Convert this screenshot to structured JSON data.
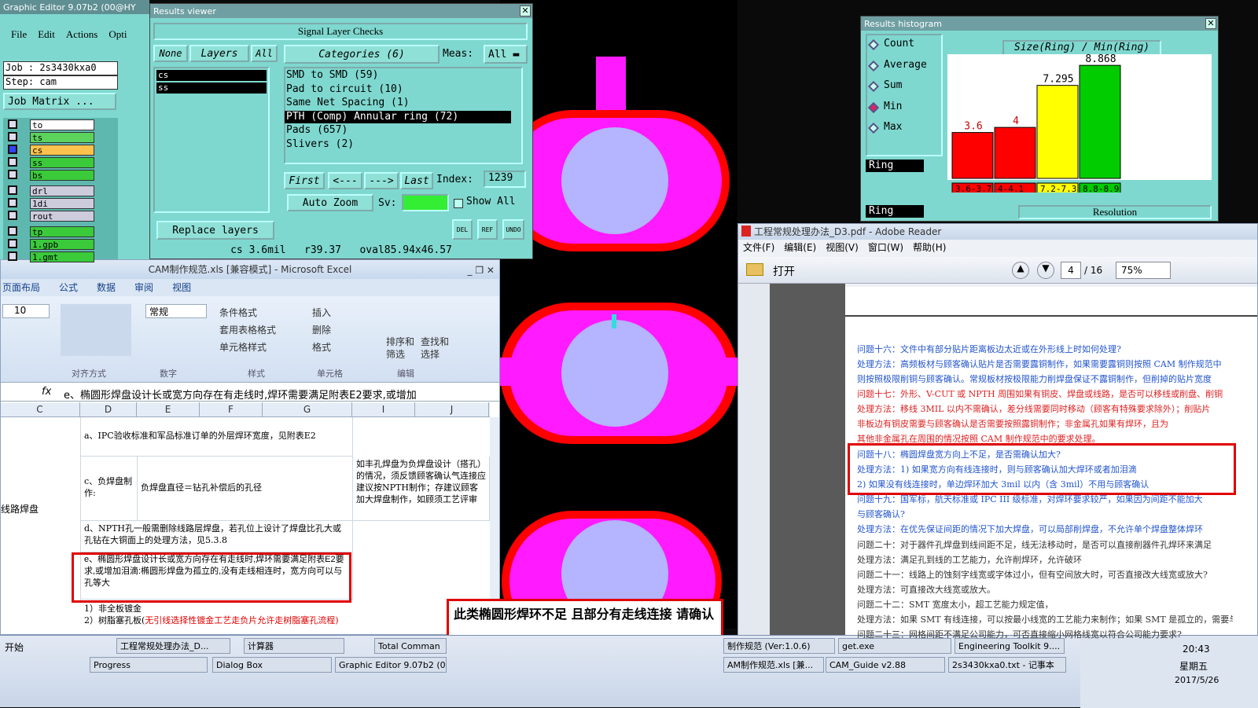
{
  "graphic_editor": {
    "title": "Graphic Editor 9.07b2 (00@HY",
    "menu": [
      "File",
      "Edit",
      "Actions",
      "Opti"
    ],
    "job": "Job : 2s3430kxa0",
    "step": "Step: cam",
    "job_matrix": "Job Matrix ...",
    "layers": [
      "to",
      "ts",
      "cs",
      "ss",
      "bs",
      "drl",
      "1di",
      "rout",
      "tp",
      "1.gpb",
      "1.gmt"
    ]
  },
  "results_viewer": {
    "title": "Results viewer",
    "header": "Signal Layer Checks",
    "none_btn": "None",
    "layers_btn": "Layers",
    "all_btn": "All",
    "categories_btn": "Categories (6)",
    "meas_label": "Meas:",
    "meas_value": "All",
    "layer_list": [
      "cs",
      "ss"
    ],
    "categories": [
      "SMD to SMD (59)",
      "Pad to circuit (10)",
      "Same Net Spacing (1)",
      "PTH (Comp) Annular ring (72)",
      "Pads (657)",
      "Slivers (2)"
    ],
    "first": "First",
    "prev": "<---",
    "next": "--->",
    "last": "Last",
    "index_label": "Index:",
    "index_value": "1239",
    "auto_zoom": "Auto Zoom",
    "sv_label": "Sv:",
    "show_all": "Show All",
    "replace_layers": "Replace layers",
    "del": "DEL",
    "ref": "REF",
    "undo": "UNDO",
    "status": "cs 3.6mil   r39.37   oval85.94x46.57"
  },
  "histogram": {
    "title": "Results histogram",
    "options": [
      "Count",
      "Average",
      "Sum",
      "Min",
      "Max"
    ],
    "selected": "Min",
    "ring_label": "Ring",
    "ring_label2": "Ring",
    "resolution": "Resolution",
    "header": "Size(Ring) / Min(Ring)",
    "chart_data": {
      "type": "bar",
      "categories": [
        "3.6-3.7",
        "4-4.1",
        "7.2-7.3",
        "8.8-8.9"
      ],
      "values": [
        3.6,
        4,
        7.295,
        8.868
      ],
      "value_labels": [
        "3.6",
        "4",
        "7.295",
        "8.868"
      ],
      "colors": [
        "#ff0000",
        "#ff0000",
        "#ffff00",
        "#00cc00"
      ],
      "ylim": [
        0,
        9
      ]
    }
  },
  "excel": {
    "title": "CAM制作规范.xls [兼容模式] - Microsoft Excel",
    "tabs": [
      "页面布局",
      "公式",
      "数据",
      "审阅",
      "视图"
    ],
    "font_size": "10",
    "num_format": "常规",
    "groups": [
      "对齐方式",
      "数字",
      "样式",
      "单元格",
      "编辑"
    ],
    "style_btns": [
      "条件格式",
      "套用表格格式",
      "单元格样式"
    ],
    "cell_btns": [
      "插入",
      "删除",
      "格式"
    ],
    "edit_btns": [
      "排序和筛选",
      "查找和选择"
    ],
    "formula": "e、椭圆形焊盘设计长或宽方向存在有走线时,焊环需要满足附表E2要求,或增加",
    "cols": [
      "C",
      "D",
      "E",
      "F",
      "G",
      "I",
      "J"
    ],
    "row_label": "线路焊盘",
    "rows": {
      "a": "a、IPC验收标准和军品标准订单的外层焊环宽度，见附表E2",
      "c_label": "c、负焊盘制作:",
      "c_value": "负焊盘直径＝钻孔补偿后的孔径",
      "c_note": "如丰孔焊盘为负焊盘设计（搭孔）的情况，须反馈顾客确认气连接应建议按NPTH制作；存建议顾客加大焊盘制作，如顾须工艺评审",
      "d": "d、NPTH孔一般需删除线路层焊盘，若孔位上设计了焊盘比孔大或孔钻在大铜面上的处理方法，见5.3.8",
      "e": "e、椭圆形焊盘设计长或宽方向存在有走线时,焊环需要满足附表E2要求,或增加泪滴:椭圆形焊盘为孤立的,没有走线相连时，宽方向可以与孔等大",
      "f1": "1）非全板镀金",
      "f2a": "2）树脂塞孔板(",
      "f2b": "无引线选择性镀金工艺走负片允许走树脂塞孔流程)"
    }
  },
  "note": "此类椭圆形焊环不足 且部分有走线连接 请确认",
  "pdf": {
    "title": "工程常规处理办法_D3.pdf - Adobe Reader",
    "menu": [
      "文件(F)",
      "编辑(E)",
      "视图(V)",
      "窗口(W)",
      "帮助(H)"
    ],
    "open": "打开",
    "page": "4",
    "pages": "/ 16",
    "zoom": "75%",
    "lines": [
      {
        "t": "问题十六：文件中有部分贴片距离板边太近或在外形线上时如何处理?",
        "c": "#2255cc"
      },
      {
        "t": "处理方法：高频板材与顾客确认贴片是否需要露铜制作，如果需要露铜则按照 CAM 制作规范中",
        "c": "#2255cc"
      },
      {
        "t": "则按照极限削铜与顾客确认。常规板材按极限能力削焊盘保证不露铜制作，但削掉的贴片宽度",
        "c": "#2255cc"
      },
      {
        "t": "问题十七：外形、V-CUT 或 NPTH 周围如果有铜皮、焊盘或线路，是否可以移线或削盘、削铜",
        "c": "#dd2222"
      },
      {
        "t": "处理方法：移线 3MIL 以内不需确认，差分线需要同时移动（顾客有特殊要求除外）；削贴片",
        "c": "#dd2222"
      },
      {
        "t": "    非板边有铜皮需要与顾客确认是否需要按照露铜制作；非金属孔如果有焊环，且为",
        "c": "#dd2222"
      },
      {
        "t": "    其他非金属孔在周围的情况按照 CAM 制作规范中的要求处理。",
        "c": "#dd2222"
      },
      {
        "t": "问题十八：椭圆焊盘宽方向上不足，是否需确认加大?",
        "c": "#2255cc"
      },
      {
        "t": "处理方法：1) 如果宽方向有线连接时，则与顾客确认加大焊环或者加泪滴",
        "c": "#2255cc"
      },
      {
        "t": "          2) 如果没有线连接时，单边焊环加大 3mil 以内（含 3mil）不用与顾客确认",
        "c": "#2255cc"
      },
      {
        "t": "问题十九：国军标，航天标准或 IPC III 级标准，对焊环要求较严，如果因为间距不能加大",
        "c": "#2255cc"
      },
      {
        "t": "    与顾客确认?",
        "c": "#2255cc"
      },
      {
        "t": "处理方法：在优先保证间距的情况下加大焊盘，可以局部削焊盘，不允许单个焊盘整体焊环",
        "c": "#2255cc"
      },
      {
        "t": "问题二十：对于器件孔焊盘到线间距不足，线无法移动时，是否可以直接削器件孔焊环来满足",
        "c": "#333333"
      },
      {
        "t": "处理方法：满足孔到线的工艺能力，允许削焊环，允许破环",
        "c": "#333333"
      },
      {
        "t": "问题二十一：线路上的蚀刻字线宽或字体过小，但有空间放大时，可否直接改大线宽或放大?",
        "c": "#333333"
      },
      {
        "t": "处理方法：可直接改大线宽或放大。",
        "c": "#333333"
      },
      {
        "t": "问题二十二：SMT 宽度太小，超工艺能力规定值，",
        "c": "#333333"
      },
      {
        "t": "处理方法：如果 SMT 有线连接，可以按最小线宽的工艺能力来制作；如果 SMT 是孤立的，需要与",
        "c": "#333333"
      },
      {
        "t": "问题二十三：网格间距不满足公司能力，可否直接缩小网格线宽以符合公司能力要求?",
        "c": "#333333"
      }
    ]
  },
  "taskbar": {
    "start": "开始",
    "row1": [
      "工程常规处理办法_D...",
      "计算器",
      "Total Comman",
      "制作规范 (Ver:1.0.6)",
      "get.exe",
      "Engineering Toolkit 9...."
    ],
    "row2": [
      "Progress",
      "Dialog Box",
      "Graphic Editor 9.07b2 (0...",
      "AM制作规范.xls [兼...",
      "CAM_Guide v2.88",
      "2s3430kxa0.txt - 记事本"
    ],
    "time": "20:43",
    "weekday": "星期五",
    "date": "2017/5/26"
  }
}
